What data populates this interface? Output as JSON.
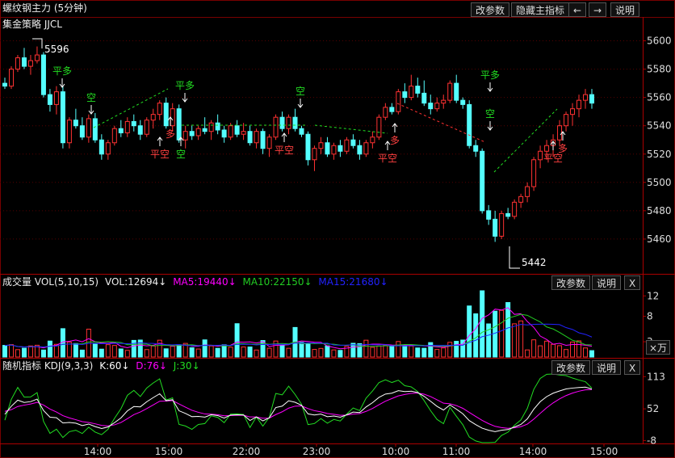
{
  "header": {
    "title": "螺纹钢主力 (5分钟)",
    "btn_params": "改参数",
    "btn_hide": "隐藏主指标",
    "btn_left": "←",
    "btn_right": "→",
    "btn_help": "说明"
  },
  "main_panel": {
    "strategy": "集金策略 JJCL",
    "high_label": "5596",
    "low_label": "5442"
  },
  "vol_panel": {
    "title": "成交量 VOL(5,10,15)",
    "vol": "VOL:12694↓",
    "ma5": "MA5:19440↓",
    "ma10": "MA10:22150↓",
    "ma15": "MA15:21680↓",
    "btn_params": "改参数",
    "btn_help": "说明",
    "btn_close": "X",
    "unit": "×万"
  },
  "kdj_panel": {
    "title": "随机指标 KDJ(9,3,3)",
    "k": "K:60↓",
    "d": "D:76↓",
    "j": "J:30↓",
    "btn_params": "改参数",
    "btn_help": "说明",
    "btn_close": "X"
  },
  "colors": {
    "up": "#ff3232",
    "down": "#54ffff",
    "ma5": "#ff00ff",
    "ma10": "#22cc22",
    "ma15": "#2222ff",
    "k": "#ffffff",
    "d": "#ff00ff",
    "j": "#22dd22",
    "sig_buy": "#ff4040",
    "sig_sell": "#22dd22"
  },
  "chart_data": {
    "type": "candlestick",
    "price_axis": {
      "min": 5436,
      "max": 5606,
      "ticks": [
        "5600",
        "5580",
        "5560",
        "5540",
        "5520",
        "5500",
        "5480",
        "5460"
      ]
    },
    "vol_axis": {
      "max": 13,
      "ticks": [
        "12",
        "8",
        "3"
      ]
    },
    "kdj_axis": {
      "min": -12,
      "max": 118,
      "ticks": [
        "113",
        "52",
        "-8"
      ]
    },
    "time_labels": [
      "14:00",
      "15:00",
      "22:00",
      "23:00",
      "10:00",
      "11:00",
      "14:00",
      "15:00"
    ],
    "candles": [
      [
        5570,
        5574,
        5566,
        5568
      ],
      [
        5568,
        5582,
        5566,
        5580
      ],
      [
        5580,
        5590,
        5578,
        5588
      ],
      [
        5588,
        5595,
        5580,
        5582
      ],
      [
        5582,
        5590,
        5576,
        5586
      ],
      [
        5586,
        5596,
        5584,
        5590
      ],
      [
        5590,
        5592,
        5560,
        5562
      ],
      [
        5562,
        5566,
        5550,
        5555
      ],
      [
        5555,
        5568,
        5548,
        5564
      ],
      [
        5564,
        5568,
        5524,
        5528
      ],
      [
        5528,
        5546,
        5524,
        5544
      ],
      [
        5544,
        5552,
        5538,
        5540
      ],
      [
        5540,
        5546,
        5530,
        5532
      ],
      [
        5532,
        5548,
        5528,
        5545
      ],
      [
        5545,
        5549,
        5528,
        5530
      ],
      [
        5530,
        5534,
        5516,
        5520
      ],
      [
        5520,
        5530,
        5516,
        5528
      ],
      [
        5528,
        5540,
        5526,
        5538
      ],
      [
        5538,
        5544,
        5532,
        5535
      ],
      [
        5535,
        5546,
        5532,
        5543
      ],
      [
        5543,
        5548,
        5536,
        5540
      ],
      [
        5540,
        5544,
        5530,
        5534
      ],
      [
        5534,
        5546,
        5532,
        5544
      ],
      [
        5544,
        5552,
        5538,
        5548
      ],
      [
        5548,
        5558,
        5544,
        5556
      ],
      [
        5556,
        5560,
        5538,
        5540
      ],
      [
        5540,
        5556,
        5536,
        5552
      ],
      [
        5552,
        5555,
        5528,
        5530
      ],
      [
        5530,
        5540,
        5524,
        5536
      ],
      [
        5536,
        5540,
        5530,
        5533
      ],
      [
        5533,
        5540,
        5530,
        5538
      ],
      [
        5538,
        5546,
        5534,
        5536
      ],
      [
        5536,
        5544,
        5530,
        5542
      ],
      [
        5542,
        5548,
        5534,
        5537
      ],
      [
        5537,
        5540,
        5528,
        5532
      ],
      [
        5532,
        5542,
        5530,
        5540
      ],
      [
        5540,
        5544,
        5532,
        5534
      ],
      [
        5534,
        5542,
        5530,
        5536
      ],
      [
        5536,
        5540,
        5526,
        5528
      ],
      [
        5528,
        5538,
        5524,
        5536
      ],
      [
        5536,
        5538,
        5520,
        5524
      ],
      [
        5524,
        5534,
        5518,
        5532
      ],
      [
        5532,
        5548,
        5530,
        5546
      ],
      [
        5546,
        5550,
        5536,
        5538
      ],
      [
        5538,
        5548,
        5534,
        5546
      ],
      [
        5546,
        5552,
        5536,
        5538
      ],
      [
        5538,
        5540,
        5532,
        5534
      ],
      [
        5534,
        5536,
        5512,
        5516
      ],
      [
        5516,
        5526,
        5508,
        5524
      ],
      [
        5524,
        5532,
        5520,
        5528
      ],
      [
        5528,
        5532,
        5518,
        5520
      ],
      [
        5520,
        5528,
        5516,
        5526
      ],
      [
        5526,
        5530,
        5518,
        5522
      ],
      [
        5522,
        5532,
        5520,
        5530
      ],
      [
        5530,
        5534,
        5524,
        5526
      ],
      [
        5526,
        5530,
        5516,
        5520
      ],
      [
        5520,
        5530,
        5518,
        5528
      ],
      [
        5528,
        5536,
        5524,
        5532
      ],
      [
        5532,
        5548,
        5530,
        5546
      ],
      [
        5546,
        5556,
        5544,
        5553
      ],
      [
        5553,
        5556,
        5548,
        5550
      ],
      [
        5550,
        5566,
        5548,
        5564
      ],
      [
        5564,
        5570,
        5556,
        5560
      ],
      [
        5560,
        5576,
        5558,
        5568
      ],
      [
        5568,
        5574,
        5560,
        5563
      ],
      [
        5563,
        5572,
        5554,
        5556
      ],
      [
        5556,
        5562,
        5548,
        5552
      ],
      [
        5552,
        5560,
        5550,
        5556
      ],
      [
        5556,
        5562,
        5552,
        5558
      ],
      [
        5558,
        5572,
        5556,
        5570
      ],
      [
        5570,
        5576,
        5556,
        5558
      ],
      [
        5558,
        5560,
        5552,
        5555
      ],
      [
        5555,
        5558,
        5524,
        5526
      ],
      [
        5526,
        5530,
        5518,
        5522
      ],
      [
        5522,
        5524,
        5478,
        5480
      ],
      [
        5480,
        5484,
        5470,
        5474
      ],
      [
        5474,
        5480,
        5458,
        5462
      ],
      [
        5462,
        5480,
        5460,
        5478
      ],
      [
        5478,
        5482,
        5474,
        5476
      ],
      [
        5476,
        5488,
        5474,
        5486
      ],
      [
        5486,
        5492,
        5482,
        5490
      ],
      [
        5490,
        5500,
        5486,
        5497
      ],
      [
        5497,
        5518,
        5494,
        5516
      ],
      [
        5516,
        5526,
        5510,
        5522
      ],
      [
        5522,
        5530,
        5516,
        5526
      ],
      [
        5526,
        5534,
        5518,
        5530
      ],
      [
        5530,
        5544,
        5526,
        5540
      ],
      [
        5540,
        5550,
        5536,
        5548
      ],
      [
        5548,
        5556,
        5540,
        5552
      ],
      [
        5552,
        5562,
        5546,
        5558
      ],
      [
        5558,
        5566,
        5552,
        5562
      ],
      [
        5562,
        5566,
        5552,
        5556
      ]
    ]
  }
}
